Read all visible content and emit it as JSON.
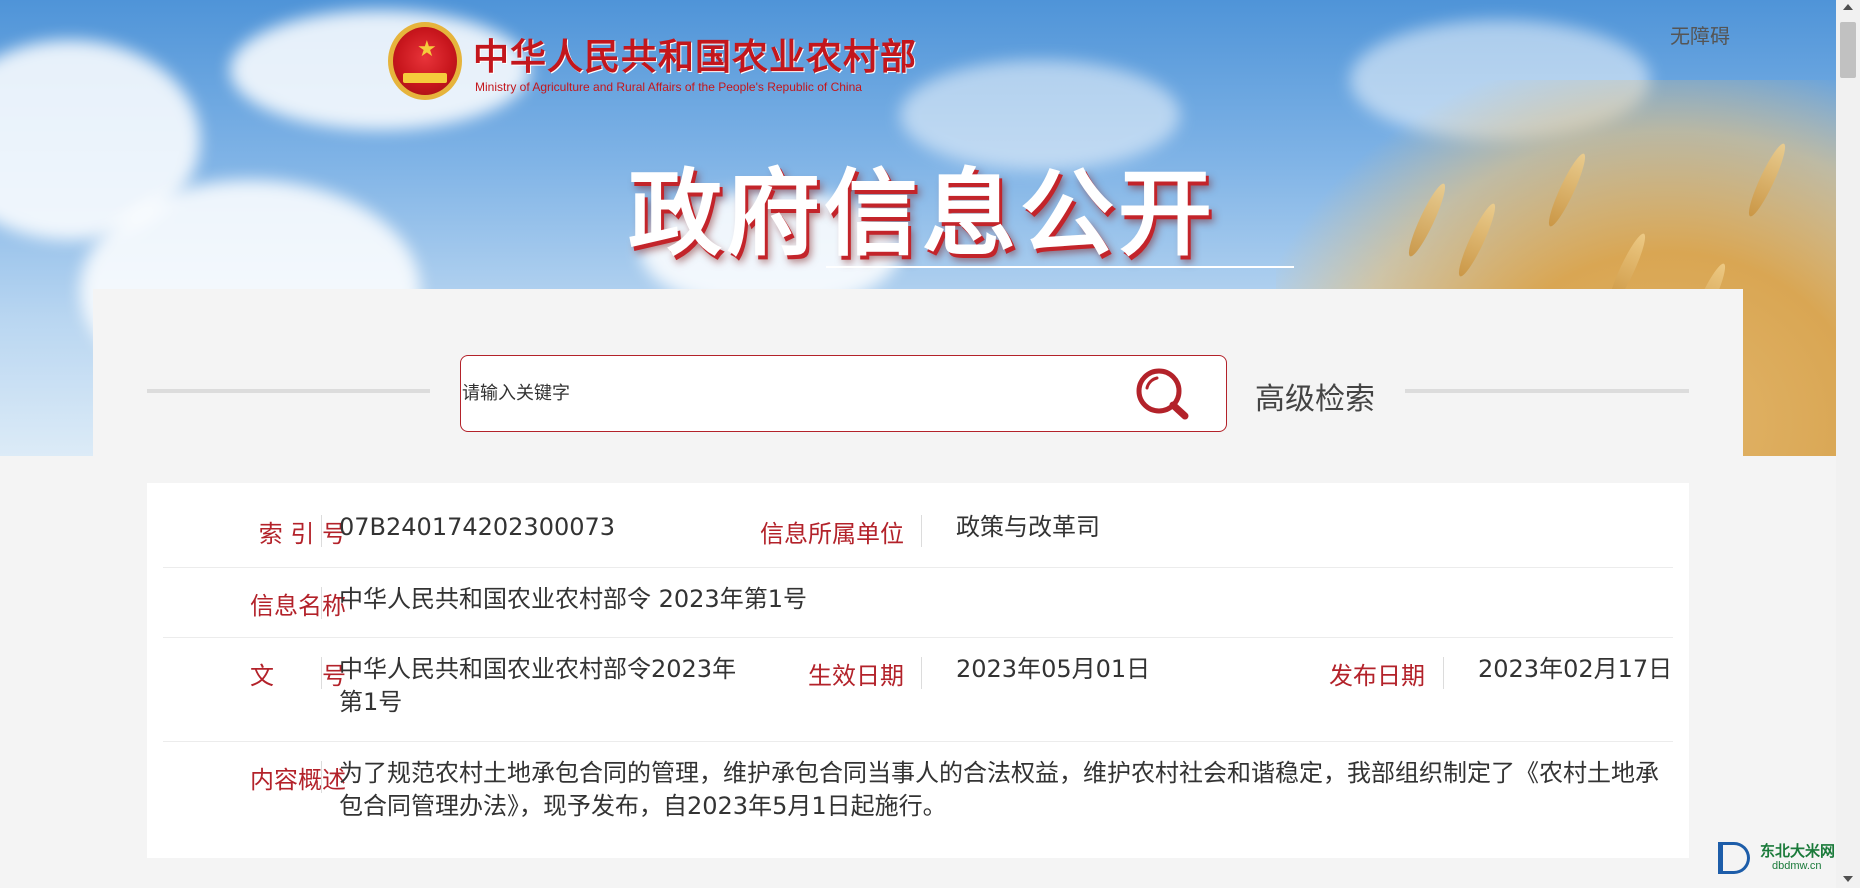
{
  "header": {
    "ministry_name_cn": "中华人民共和国农业农村部",
    "ministry_name_en": "Ministry of Agriculture and Rural Affairs of the People's Republic of China",
    "accessibility_link": "无障碍",
    "page_title": "政府信息公开"
  },
  "search": {
    "placeholder": "请输入关键字",
    "advanced_search_label": "高级检索"
  },
  "info": {
    "index_number": {
      "label": "索 引 号",
      "value": "07B240174202300073"
    },
    "department": {
      "label": "信息所属单位",
      "value": "政策与改革司"
    },
    "info_name": {
      "label": "信息名称",
      "value": "中华人民共和国农业农村部令 2023年第1号"
    },
    "document_number": {
      "label": "文　　号",
      "value": "中华人民共和国农业农村部令2023年第1号"
    },
    "effective_date": {
      "label": "生效日期",
      "value": "2023年05月01日"
    },
    "publish_date": {
      "label": "发布日期",
      "value": "2023年02月17日"
    },
    "summary": {
      "label": "内容概述",
      "value": "为了规范农村土地承包合同的管理，维护承包合同当事人的合法权益，维护农村社会和谐稳定，我部组织制定了《农村土地承包合同管理办法》，现予发布，自2023年5月1日起施行。"
    }
  },
  "watermark": {
    "name_cn": "东北大米网",
    "domain": "dbdmw.cn"
  },
  "colors": {
    "accent_red": "#b3222a",
    "emblem_gold": "#e6b43c",
    "watermark_green": "#1a7a3a"
  }
}
